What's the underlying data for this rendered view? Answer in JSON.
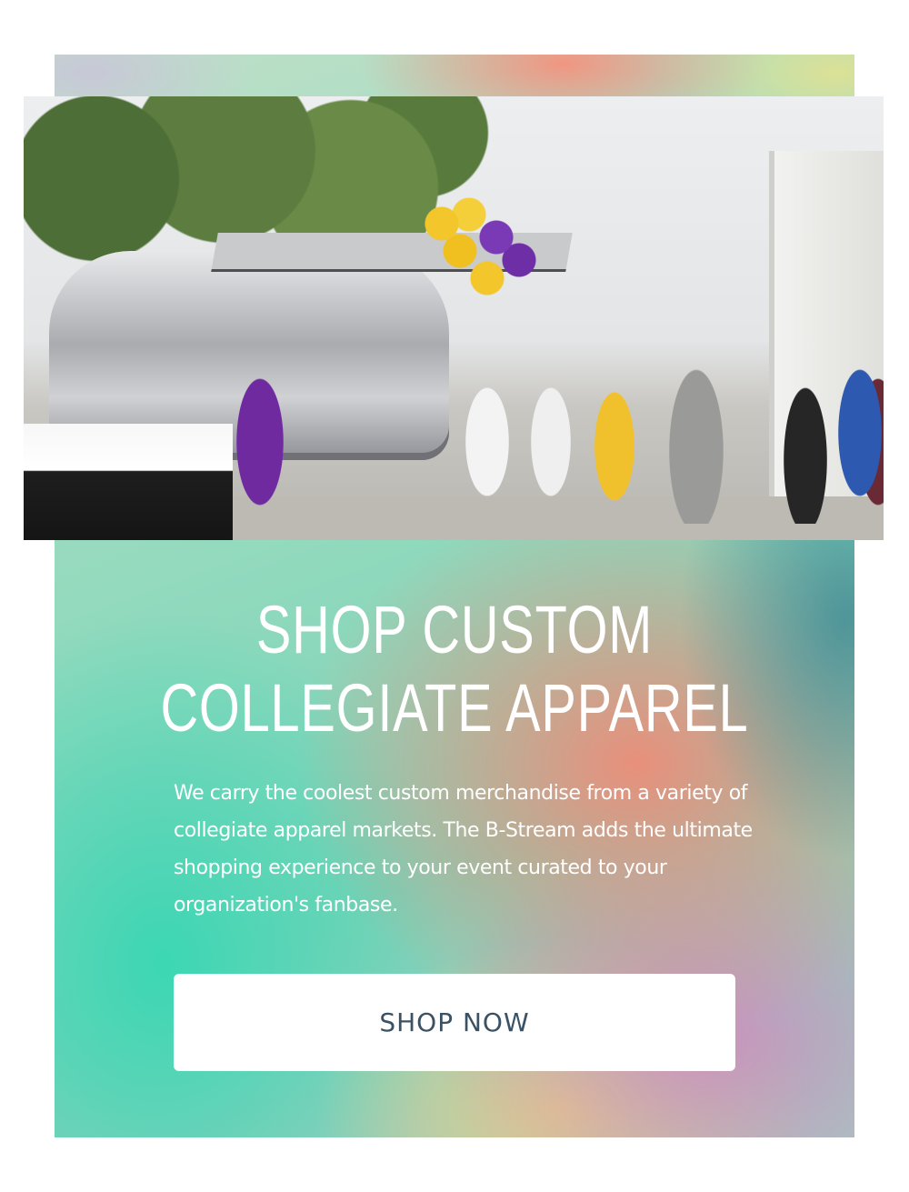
{
  "promo": {
    "headline_line1": "SHOP CUSTOM",
    "headline_line2": "COLLEGIATE APPAREL",
    "description": "We carry the coolest custom merchandise from a variety of collegiate apparel markets.  The B-Stream adds the ultimate shopping experience to your event curated to your organization's fanbase.",
    "cta_label": "SHOP NOW"
  },
  "photo": {
    "alt": "Airstream merchandise trailer at a collegiate game day event"
  },
  "colors": {
    "headline": "#ffffff",
    "body_text": "#ffffff",
    "button_bg": "#ffffff",
    "button_text": "#3b5264",
    "gradient_teal": "#3cd7b4",
    "gradient_coral": "#ee8c78",
    "gradient_lilac": "#cd8cbe"
  }
}
